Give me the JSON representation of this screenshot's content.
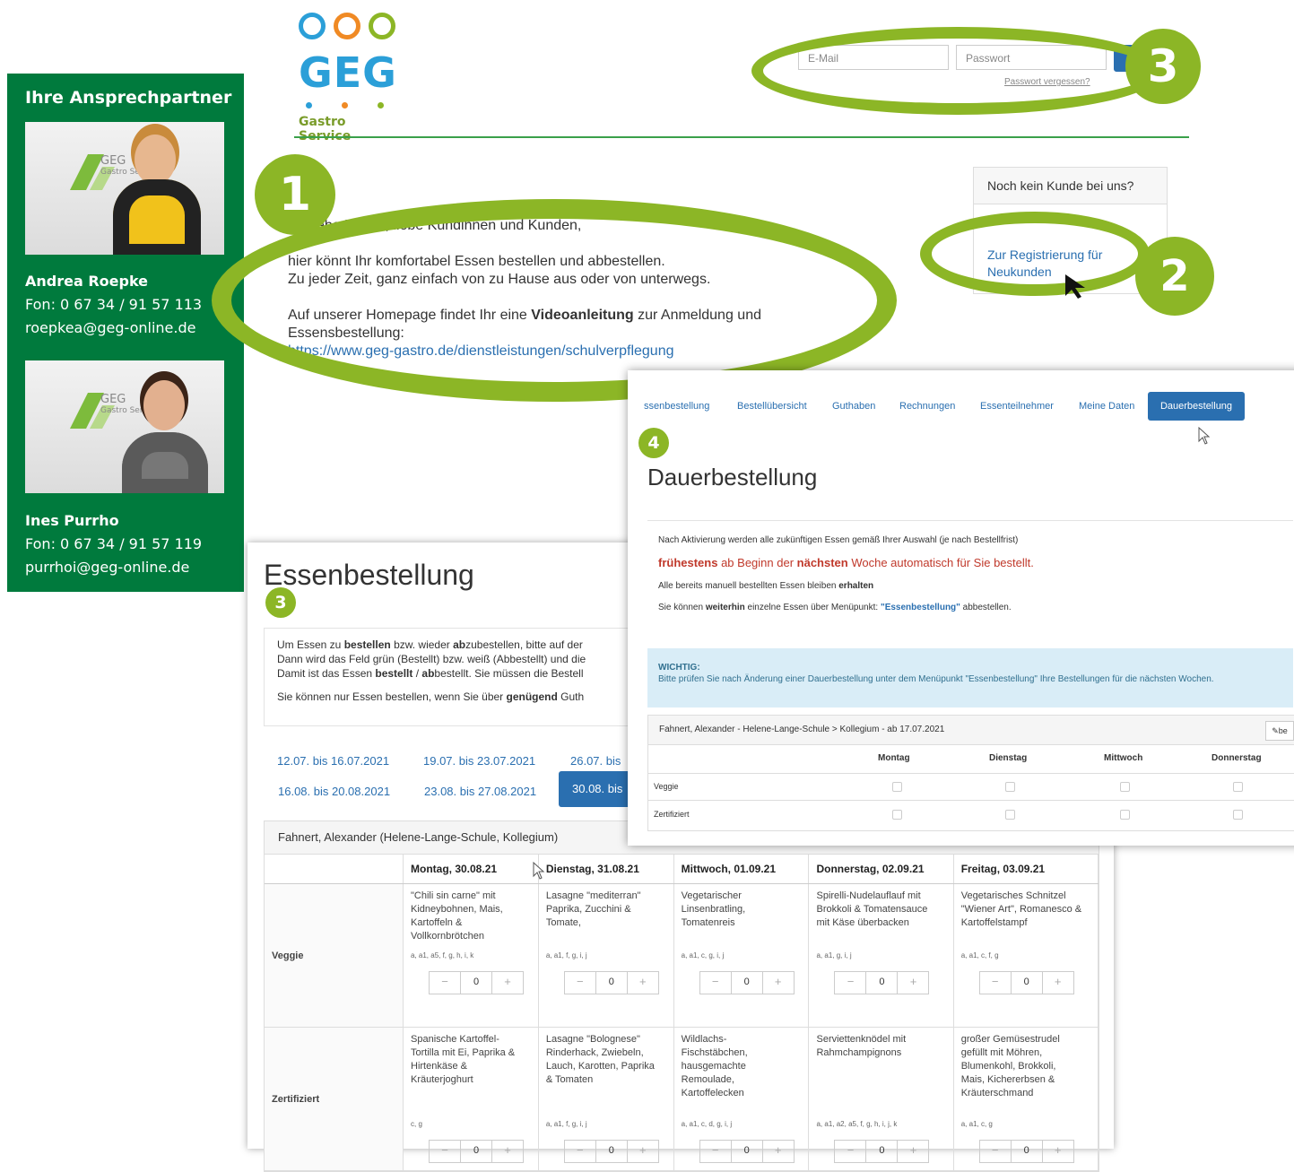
{
  "sidebar": {
    "title": "Ihre Ansprechpartner",
    "photo_brand": "GEG",
    "photo_brand_sub": "Gastro Service",
    "contacts": [
      {
        "name": "Andrea Roepke",
        "phone": "Fon: 0 67 34 / 91 57 113",
        "email": "roepkea@geg-online.de"
      },
      {
        "name": "Ines Purrho",
        "phone": "Fon: 0 67 34 / 91 57 119",
        "email": "purrhoi@geg-online.de"
      }
    ]
  },
  "header": {
    "logo_text": "GEG",
    "logo_sub": "Gastro Service",
    "email_placeholder": "E-Mail",
    "password_placeholder": "Passwort",
    "forgot": "Passwort vergessen?"
  },
  "badges": {
    "b1": "1",
    "b2": "2",
    "b3": "3",
    "b3_small": "3",
    "b4_small": "4"
  },
  "welcome": {
    "line1": "…, liebe Kinder, liebe Kundinnen und Kunden,",
    "line2": "hier könnt Ihr komfortabel Essen bestellen und abbestellen.",
    "line3": "Zu jeder Zeit, ganz einfach von zu Hause aus oder von unterwegs.",
    "line4a": "Auf unserer Homepage findet Ihr eine ",
    "line4b": "Videoanleitung",
    "line4c": " zur Anmeldung und",
    "line5": "Essensbestellung:",
    "link": "https://www.geg-gastro.de/dienstleistungen/schulverpflegung"
  },
  "register": {
    "header": "Noch kein Kunde bei uns?",
    "link": "Zur Registrierung für Neukunden"
  },
  "essen": {
    "title": "Essenbestellung",
    "info1a": "Um Essen zu ",
    "info1b": "bestellen",
    "info1c": " bzw. wieder ",
    "info1d": "ab",
    "info1e": "zubestellen, bitte auf der",
    "info2": "Dann wird das Feld grün (Bestellt) bzw. weiß (Abbestellt) und die",
    "info3a": "Damit ist das Essen ",
    "info3b": "bestellt",
    "info3c": " / ",
    "info3d": "ab",
    "info3e": "bestellt. Sie müssen die Bestell",
    "info4a": "Sie können nur Essen bestellen, wenn Sie über ",
    "info4b": "genügend",
    "info4c": " Guth",
    "weeks": [
      "12.07. bis 16.07.2021",
      "19.07. bis 23.07.2021",
      "26.07. bis",
      "16.08. bis 20.08.2021",
      "23.08. bis 27.08.2021"
    ],
    "week_active": "30.08. bis",
    "table_header": "Fahnert, Alexander (Helene-Lange-Schule, Kollegium)",
    "days": [
      "Montag, 30.08.21",
      "Dienstag, 31.08.21",
      "Mittwoch, 01.09.21",
      "Donnerstag, 02.09.21",
      "Freitag, 03.09.21"
    ],
    "rows": [
      {
        "label": "Veggie",
        "meals": [
          {
            "text": "\"Chili sin carne\" mit Kidneybohnen, Mais, Kartoffeln & Vollkornbrötchen",
            "allergens": "a, a1, a5, f, g, h, i, k",
            "qty": "0"
          },
          {
            "text": "Lasagne \"mediterran\" Paprika, Zucchini & Tomate,",
            "allergens": "a, a1, f, g, i, j",
            "qty": "0"
          },
          {
            "text": "Vegetarischer Linsenbratling, Tomatenreis",
            "allergens": "a, a1, c, g, i, j",
            "qty": "0"
          },
          {
            "text": "Spirelli-Nudelauflauf mit Brokkoli & Tomatensauce mit Käse überbacken",
            "allergens": "a, a1, g, i, j",
            "qty": "0"
          },
          {
            "text": "Vegetarisches Schnitzel \"Wiener Art\", Romanesco & Kartoffelstampf",
            "allergens": "a, a1, c, f, g",
            "qty": "0"
          }
        ]
      },
      {
        "label": "Zertifiziert",
        "meals": [
          {
            "text": "Spanische Kartoffel-Tortilla mit Ei, Paprika & Hirtenkäse & Kräuterjoghurt",
            "allergens": "c, g",
            "qty": "0"
          },
          {
            "text": "Lasagne \"Bolognese\" Rinderhack, Zwiebeln, Lauch, Karotten, Paprika & Tomaten",
            "allergens": "a, a1, f, g, i, j",
            "qty": "0"
          },
          {
            "text": "Wildlachs-Fischstäbchen, hausgemachte Remoulade, Kartoffelecken",
            "allergens": "a, a1, c, d, g, i, j",
            "qty": "0"
          },
          {
            "text": "Serviettenknödel mit Rahmchampignons",
            "allergens": "a, a1, a2, a5, f, g, h, i, j, k",
            "qty": "0"
          },
          {
            "text": "großer Gemüsestrudel gefüllt mit Möhren, Blumenkohl, Brokkoli, Mais, Kichererbsen & Kräuterschmand",
            "allergens": "a, a1, c, g",
            "qty": "0"
          }
        ]
      }
    ]
  },
  "dauer": {
    "nav": [
      "ssenbestellung",
      "Bestellübersicht",
      "Guthaben",
      "Rechnungen",
      "Essenteilnehmer",
      "Meine Daten"
    ],
    "nav_active": "Dauerbestellung",
    "title": "Dauerbestellung",
    "text1": "Nach Aktivierung werden alle zukünftigen Essen gemäß Ihrer Auswahl (je nach Bestellfrist)",
    "text2a": "frühestens",
    "text2b": " ab Beginn der ",
    "text2c": "nächsten",
    "text2d": " Woche automatisch für Sie bestellt.",
    "text3a": "Alle bereits manuell bestellten Essen bleiben ",
    "text3b": "erhalten",
    "text4a": "Sie können ",
    "text4b": "weiterhin",
    "text4c": " einzelne Essen über Menüpunkt: ",
    "text4d": "\"Essenbestellung\"",
    "text4e": " abbestellen.",
    "warn_title": "WICHTIG:",
    "warn_text": "Bitte prüfen Sie nach Änderung einer Dauerbestellung unter dem Menüpunkt \"Essenbestellung\" Ihre Bestellungen für die nächsten Wochen.",
    "table_header": "Fahnert, Alexander - Helene-Lange-Schule > Kollegium - ab 17.07.2021",
    "edit_label": "be",
    "days": [
      "Montag",
      "Dienstag",
      "Mittwoch",
      "Donnerstag"
    ],
    "rows": [
      "Veggie",
      "Zertifiziert"
    ]
  },
  "colors": {
    "green": "#007a3d",
    "accent": "#8cb626",
    "blue": "#2a6fb0",
    "red": "#c0392b"
  }
}
